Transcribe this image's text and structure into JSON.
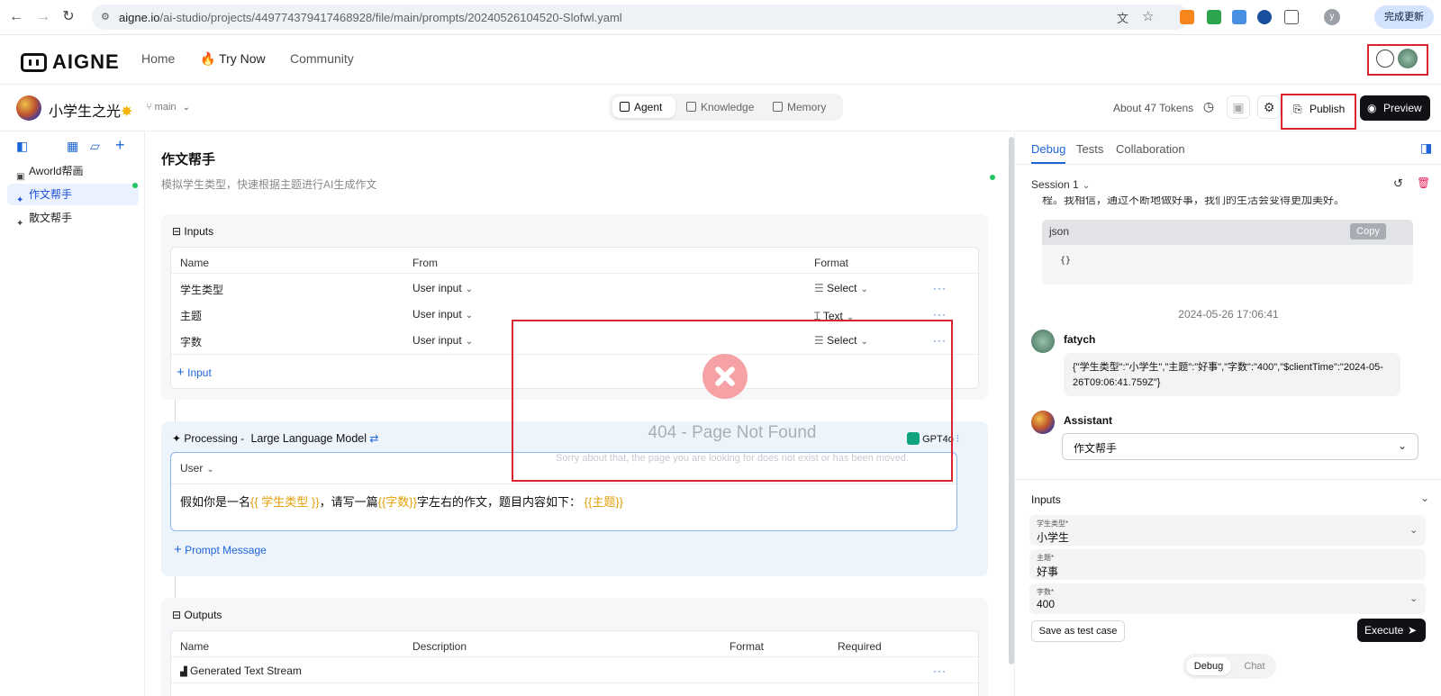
{
  "browser": {
    "url_host": "aigne.io",
    "url_path": "/ai-studio/projects/449774379417468928/file/main/prompts/20240526104520-Slofwl.yaml",
    "profile_initial": "y",
    "update_label": "完成更新"
  },
  "nav": {
    "logo": "AIGNE",
    "home": "Home",
    "try_now": "Try Now",
    "community": "Community"
  },
  "project": {
    "name": "小学生之光",
    "branch": "main",
    "tabs": [
      "Agent",
      "Knowledge",
      "Memory"
    ],
    "tokens": "About 47 Tokens",
    "publish": "Publish",
    "preview": "Preview"
  },
  "sidebar": {
    "items": [
      "Aworld帮画",
      "作文帮手",
      "散文帮手"
    ]
  },
  "agent": {
    "title": "作文帮手",
    "description": "模拟学生类型，快速根据主题进行AI生成作文",
    "inputs_title": "Inputs",
    "inputs_headers": [
      "Name",
      "From",
      "Format"
    ],
    "inputs_rows": [
      {
        "name": "学生类型",
        "from": "User input",
        "format": "Select"
      },
      {
        "name": "主题",
        "from": "User input",
        "format": "Text"
      },
      {
        "name": "字数",
        "from": "User input",
        "format": "Select"
      }
    ],
    "add_input": "Input",
    "processing_prefix": "Processing -",
    "processing_title": "Large Language Model",
    "model": "GPT4o",
    "role": "User",
    "prompt_parts": [
      "假如你是一名",
      "{{ 学生类型 }}",
      "，请写一篇",
      "{{字数}}",
      "字左右的作文，题目内容如下：",
      "{{主题}}"
    ],
    "add_prompt": "Prompt Message",
    "outputs_title": "Outputs",
    "outputs_headers": [
      "Name",
      "Description",
      "Format",
      "Required"
    ],
    "outputs_rows": [
      {
        "name": "Generated Text Stream"
      }
    ]
  },
  "error": {
    "title": "404 - Page Not Found",
    "message": "Sorry about that, the page you are looking for does not exist or has been moved."
  },
  "debug": {
    "tabs": [
      "Debug",
      "Tests",
      "Collaboration"
    ],
    "session": "Session 1",
    "truncated_text": "程。我相信，通过不断地做好事，我们的生活会变得更加美好。",
    "code_lang": "json",
    "copy": "Copy",
    "code_body": "{}",
    "timestamp": "2024-05-26 17:06:41",
    "user_name": "fatych",
    "user_message": "{\"学生类型\":\"小学生\",\"主题\":\"好事\",\"字数\":\"400\",\"$clientTime\":\"2024-05-26T09:06:41.759Z\"}",
    "assistant_name": "Assistant",
    "assistant_select": "作文帮手",
    "inputs_title": "Inputs",
    "fields": [
      {
        "label": "学生类型*",
        "value": "小学生"
      },
      {
        "label": "主题*",
        "value": "好事"
      },
      {
        "label": "字数*",
        "value": "400"
      }
    ],
    "save_test": "Save as test case",
    "execute": "Execute",
    "bottom_tabs": [
      "Debug",
      "Chat"
    ]
  },
  "colors": {
    "accent": "#1d64d8",
    "variable": "#e3a008",
    "highlight": "#d9252f",
    "dark": "#0f1115"
  }
}
